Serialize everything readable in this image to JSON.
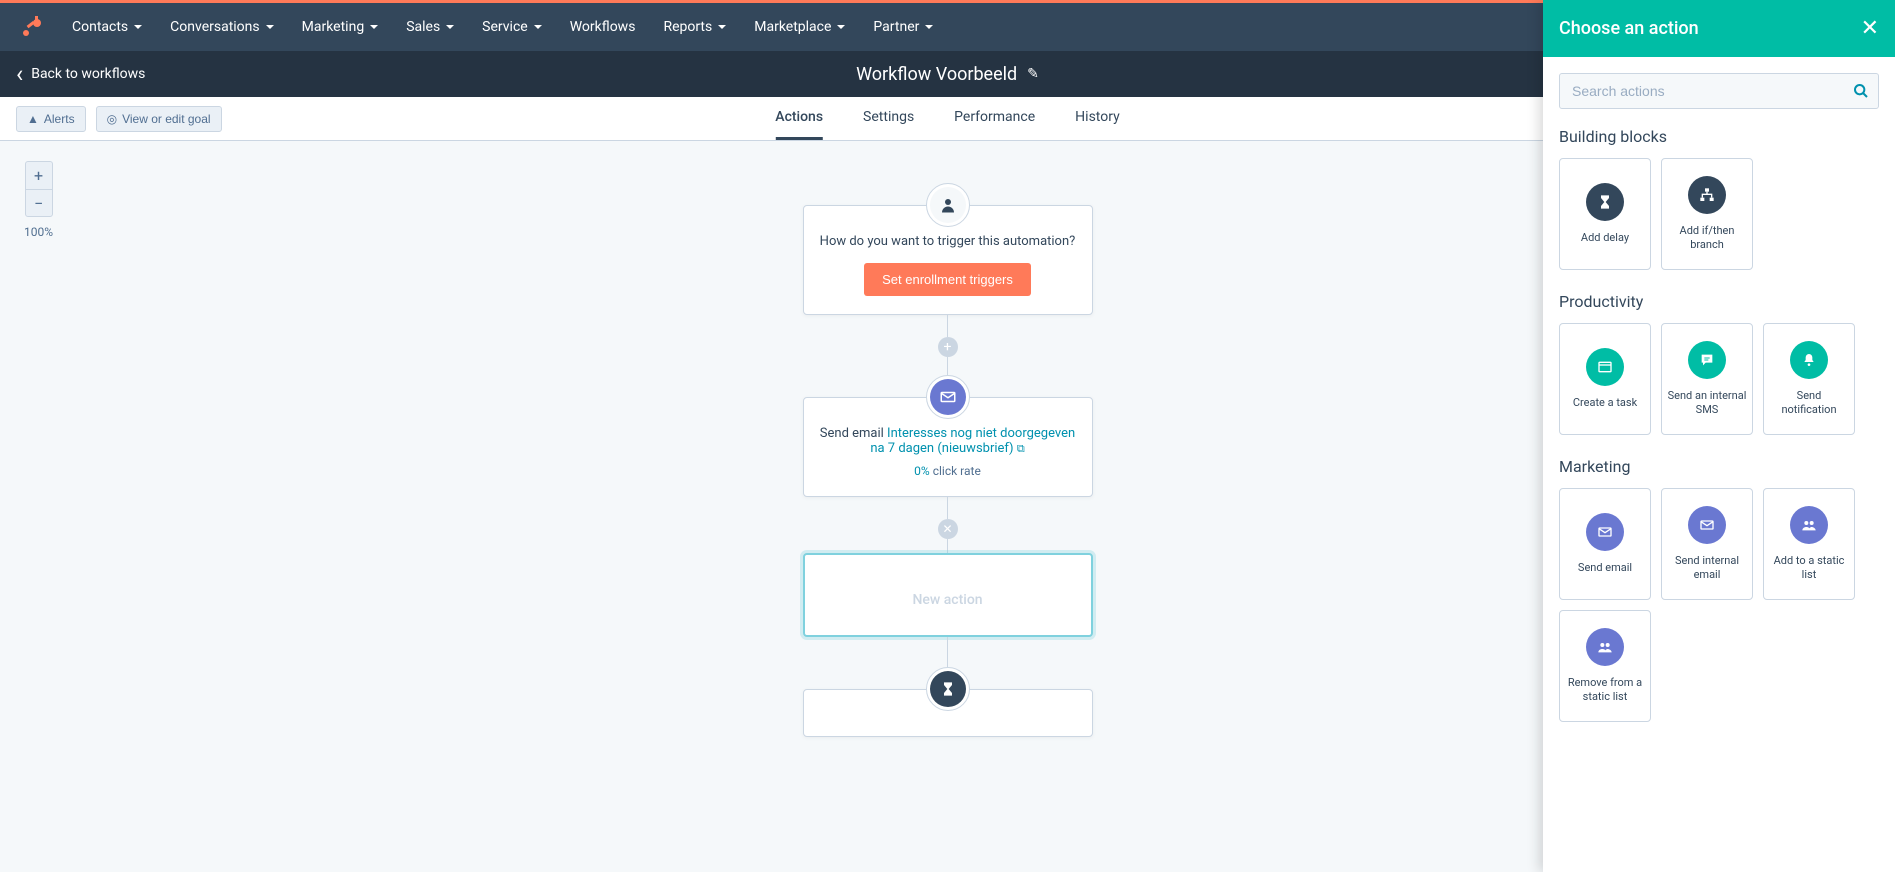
{
  "nav": {
    "items": [
      "Contacts",
      "Conversations",
      "Marketing",
      "Sales",
      "Service",
      "Workflows",
      "Reports",
      "Marketplace",
      "Partner"
    ]
  },
  "subheader": {
    "back": "Back to workflows",
    "title": "Workflow Voorbeeld"
  },
  "toolbar": {
    "alerts": "Alerts",
    "goal": "View or edit goal",
    "tabs": [
      "Actions",
      "Settings",
      "Performance",
      "History"
    ]
  },
  "zoom": {
    "plus": "+",
    "minus": "−",
    "level": "100%"
  },
  "flow": {
    "trigger_question": "How do you want to trigger this automation?",
    "trigger_button": "Set enrollment triggers",
    "email_prefix": "Send email ",
    "email_name": "Interesses nog niet doorgegeven na 7 dagen (nieuwsbrief)",
    "click_pct": "0%",
    "click_suffix": " click rate",
    "new_action": "New action"
  },
  "panel": {
    "title": "Choose an action",
    "search_placeholder": "Search actions",
    "sections": {
      "building": {
        "title": "Building blocks",
        "tiles": [
          "Add delay",
          "Add if/then branch"
        ]
      },
      "productivity": {
        "title": "Productivity",
        "tiles": [
          "Create a task",
          "Send an internal SMS",
          "Send notification"
        ]
      },
      "marketing": {
        "title": "Marketing",
        "tiles": [
          "Send email",
          "Send internal email",
          "Add to a static list",
          "Remove from a static list"
        ]
      }
    }
  }
}
